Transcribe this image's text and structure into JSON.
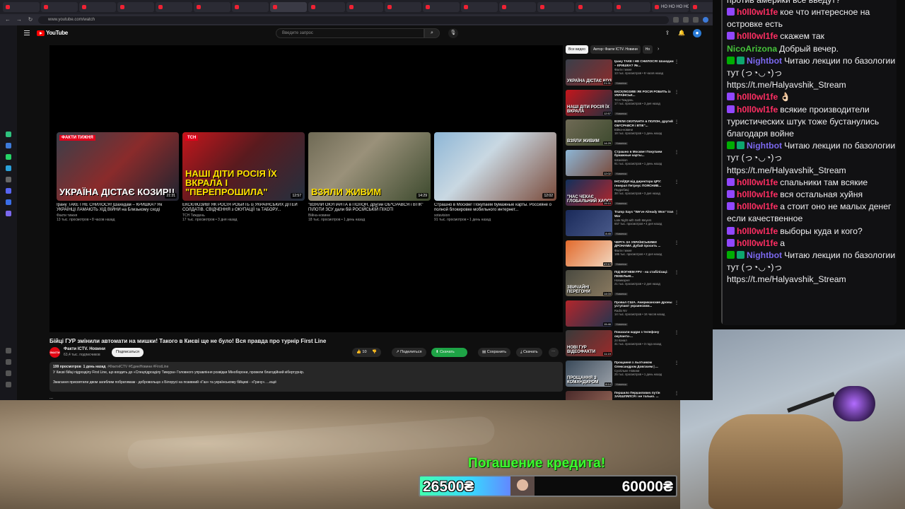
{
  "browser": {
    "tabs": [
      "",
      "",
      "",
      "",
      "",
      "",
      "",
      "",
      "",
      "",
      "",
      "",
      "",
      "",
      "",
      "",
      "",
      "НО НО НО НО",
      "",
      "НО НО",
      ""
    ],
    "url": "www.youtube.com/watch"
  },
  "youtube": {
    "logo_text": "YouTube",
    "search_placeholder": "Введите запрос",
    "end_cards": [
      {
        "caption": "УКРАЇНА ДІСТАЄ КОЗИР!!",
        "tag": "ФАКТИ ТИЖНЯ",
        "duration": "21:31",
        "title": "Ірану ТАКЕ І НЕ СНИЛОСЯ! Шахедам – КРИШКА? Як УКРАЇНЦІ ЛАМАЮТЬ ХІД ВІЙНИ на Близькому сході",
        "channel": "Факти тижня",
        "meta": "13 тыс. просмотров • 8 часов назад",
        "bg": "linear-gradient(135deg,#3a3f4a 0%,#8a2b2b 50%,#1e2430 100%)"
      },
      {
        "caption": "НАШІ ДІТИ РОСІЯ ЇХ ВКРАЛА І \"ПЕРЕПРОШИЛА\"",
        "tag": "ТСН",
        "duration": "12:57",
        "title": "ЕКСКЛЮЗИВ! ЯК РОСІЯ РОБИТЬ із УКРАЇНСЬКИХ ДІТЕЙ СОЛДАТІВ. СВІДЧЕННЯ з ОКУПАЦІЇ та ТАБОРУ...",
        "channel": "ТСН Тиждень",
        "meta": "17 тыс. просмотров • 3 дня назад",
        "bg": "linear-gradient(135deg,#c4161c 0%,#5a1a1e 45%,#24303f 100%)"
      },
      {
        "caption": "ВЗЯЛИ ЖИВИМ",
        "tag": "",
        "duration": "14:29",
        "title": "\"ВЗЯЛИ ОКУПАНТА в ПОЛОН, другий ОБ*СРАВСЯ і ВТІК\" ПІЛОТИ ЗСУ дали бій РОСІЙСЬКІЙ ПІХОТІ",
        "channel": "Війна-новини",
        "meta": "18 тыс. просмотров • 1 день назад",
        "bg": "linear-gradient(135deg,#6f6a55 0%,#9a917a 40%,#3d4a2e 100%)"
      },
      {
        "caption": "",
        "tag": "",
        "duration": "12:02",
        "title": "Страшно в Москве! Покупаем бумажные карты. Россияне о полной блокировке мобильного интернет...",
        "channel": "sotavision",
        "meta": "91 тыс. просмотров • 1 день назад",
        "bg": "linear-gradient(135deg,#8db6d6 0%,#c9d8e2 40%,#7a4a3a 100%)"
      }
    ],
    "video_title": "Бійці ГУР змінили автомати на мишки! Такого в Києві ще не було! Вся правда про турнір First Line",
    "channel_name": "Факти ICTV. Новини",
    "channel_subs": "63,4 тыс. подписчиков",
    "avatar_text": "ФАКТИ",
    "subscribe_label": "Подписаться",
    "actions": {
      "likes": "10",
      "share": "Поделиться",
      "download_app": "Скачать",
      "download_size": "",
      "save": "Сохранить",
      "download": "Скачать"
    },
    "description": {
      "views": "199 просмотров",
      "date": "1 день назад",
      "tags": "#ФактиICTV #ЄдиніНовини #FirstLine",
      "line2": "У Києві бійці підрозділу First Line, що входить до «Спецпідрозділу Тимура» Головного управління розвідки Міноборони, провели благодійний кібертурнір.",
      "line3": "Змагання присвятили двом загиблим побратимам - добровольцю з Білорусі на позивний «Газ» та українському бійцеві - «Грачу». ...ещё"
    },
    "comments_peek": "...",
    "chips": [
      "Все видео",
      "Автор: Факти ICTV. Новини",
      "Но"
    ],
    "related": [
      {
        "title": "Ірану ТАКЕ І НЕ СНИЛОСЯ! Шахедам – КРИШКА? Як...",
        "channel": "Факти тижня",
        "meta": "13 тыс. просмотров • 8 часов назад",
        "badge": "Новинка",
        "duration": "21:31",
        "caption": "УКРАЇНА ДІСТАЄ КОЗ",
        "bg": "linear-gradient(135deg,#3a3f4a,#8a2b2b)"
      },
      {
        "title": "ЕКСКЛЮЗИВ! ЯК РОСІЯ РОБИТЬ із УКРАЇНСЬК...",
        "channel": "ТСН Тиждень",
        "meta": "17 тыс. просмотров • 3 дня назад",
        "badge": "Новинка",
        "duration": "12:57",
        "caption": "НАШІ ДІТИ РОСІЯ ЇХ ВКРАЛА",
        "bg": "linear-gradient(135deg,#c4161c,#24303f)"
      },
      {
        "title": "ВЗЯЛИ ОКУПАНТА в ПОЛОН, другий ОБ*СРАВСЯ і ВТІК\"...",
        "channel": "Війна-новини",
        "meta": "18 тыс. просмотров • 1 день назад",
        "badge": "Новинка",
        "duration": "14:29",
        "caption": "ВЗЯЛИ ЖИВИМ",
        "bg": "linear-gradient(135deg,#6f6a55,#3d4a2e)"
      },
      {
        "title": "Страшно в Москве! Покупаем бумажные карты...",
        "channel": "sotavision",
        "meta": "91 тыс. просмотров • 1 день назад",
        "badge": "Новинка",
        "duration": "12:02",
        "caption": "",
        "bg": "linear-gradient(135deg,#8db6d6,#7a4a3a)"
      },
      {
        "title": "ІНСАЙДИ від директора ЦРУ: генерал Петреус ПОЯСНИВ...",
        "channel": "Подробиці",
        "meta": "38 тыс. просмотров • 3 дня назад",
        "badge": "Новинка",
        "duration": "19:10",
        "caption": "\"НАС ЧЕКАЄ ГЛОБАЛЬНИЙ ХАОС\"",
        "bg": "linear-gradient(135deg,#12305c,#b3262b)"
      },
      {
        "title": "Trump Says \"We've Already Won\" Iran War",
        "channel": "Late Night with Seth Meyers",
        "meta": "657 тыс. просмотров • 4 дня назад",
        "badge": "Новинка",
        "duration": "8:45",
        "caption": "",
        "bg": "linear-gradient(135deg,#1a2a5a,#4a5a8a)"
      },
      {
        "title": "ЧЕРГА ЗА УКРАЇНСЬКИМИ ДРОНАМИ. Дубай просить ...",
        "channel": "Факти тижня",
        "meta": "185 тыс. просмотров • 2 дня назад",
        "badge": "Новинка",
        "duration": "47:17",
        "caption": "",
        "bg": "linear-gradient(135deg,#e26a2c,#f2d7c0)"
      },
      {
        "title": "ПІД ВОГНЕМ FPV - на стабілізаці: ПЕКЕЛЬНІ...",
        "channel": "Новинарня",
        "meta": "21 тыс. просмотров • 2 дня назад",
        "badge": "Новинка",
        "duration": "14:03",
        "caption": "ЗВИЧАЙНІ ПЕРЕГОНИ",
        "bg": "linear-gradient(135deg,#4a4a40,#8a7a60)"
      },
      {
        "title": "Провал США. Американские дроны уступают украинским...",
        "channel": "Radio NV",
        "meta": "14 тыс. просмотров • 16 часов назад",
        "badge": "Новинка",
        "duration": "15:46",
        "caption": "",
        "bg": "linear-gradient(135deg,#b3262b,#23344f)"
      },
      {
        "title": "Показали кадри з телефону окупанта-...",
        "channel": "24 Канал",
        "meta": "31 тыс. просмотров • 3 года назад",
        "badge": "",
        "duration": "11:19",
        "caption": "НОВІ ГУР ВІДЕОФАКТИ",
        "bg": "linear-gradient(135deg,#3a3a3a,#9a2a2a)"
      },
      {
        "title": "Прощання з льотчиком Олександром Довгачем | ...",
        "channel": "Суспільне Новини",
        "meta": "25 тыс. просмотров • 1 день назад",
        "badge": "Новинка",
        "duration": "8:14",
        "caption": "ПРОЩАННЯ З КОМАНДИРОМ",
        "bg": "linear-gradient(135deg,#3a4a5a,#9aa0a8)"
      },
      {
        "title": "Першило Першилович путін ЗАКШЛЯЛСЯ і не только. ...",
        "channel": "",
        "meta": "",
        "badge": "",
        "duration": "",
        "caption": "",
        "bg": "linear-gradient(135deg,#4a2a2a,#9a6a5a)"
      }
    ]
  },
  "chat": {
    "top_line": "против америки все введут?",
    "messages": [
      {
        "badges": [
          "sub"
        ],
        "user": "h0ll0wl1fe",
        "color": "#ff2e63",
        "text": "кое что интересное на островке есть"
      },
      {
        "badges": [
          "sub"
        ],
        "user": "h0ll0wl1fe",
        "color": "#ff2e63",
        "text": "скажем так"
      },
      {
        "badges": [],
        "user": "NicoArizona",
        "color": "#46c33b",
        "text": "Добрый вечер."
      },
      {
        "badges": [
          "check",
          "bot"
        ],
        "user": "Nightbot",
        "color": "#7b68ee",
        "text": "Читаю лекции по базологии тут (っ◔◡◔)っ https://t.me/Halyavshik_Stream"
      },
      {
        "badges": [
          "sub"
        ],
        "user": "h0ll0wl1fe",
        "color": "#ff2e63",
        "text": "👌🏻"
      },
      {
        "badges": [
          "sub"
        ],
        "user": "h0ll0wl1fe",
        "color": "#ff2e63",
        "text": "всякие производители туристических штук тоже бустанулись благодаря войне"
      },
      {
        "badges": [
          "check",
          "bot"
        ],
        "user": "Nightbot",
        "color": "#7b68ee",
        "text": "Читаю лекции по базологии тут (っ◔◡◔)っ https://t.me/Halyavshik_Stream"
      },
      {
        "badges": [
          "sub"
        ],
        "user": "h0ll0wl1fe",
        "color": "#ff2e63",
        "text": "спальники там всякие"
      },
      {
        "badges": [
          "sub"
        ],
        "user": "h0ll0wl1fe",
        "color": "#ff2e63",
        "text": "вся остальная хуйня"
      },
      {
        "badges": [
          "sub"
        ],
        "user": "h0ll0wl1fe",
        "color": "#ff2e63",
        "text": "а стоит оно не малых денег если качественное"
      },
      {
        "badges": [
          "sub"
        ],
        "user": "h0ll0wl1fe",
        "color": "#ff2e63",
        "text": "выборы куда и кого?"
      },
      {
        "badges": [
          "sub"
        ],
        "user": "h0ll0wl1fe",
        "color": "#ff2e63",
        "text": "а"
      },
      {
        "badges": [
          "check",
          "bot"
        ],
        "user": "Nightbot",
        "color": "#7b68ee",
        "text": "Читаю лекции по базологии тут (っ◔◡◔)っ https://t.me/Halyavshik_Stream"
      }
    ]
  },
  "credit": {
    "title": "Погашение кредита!",
    "current": "26500₴",
    "goal": "60000₴",
    "progress": 0.44
  }
}
